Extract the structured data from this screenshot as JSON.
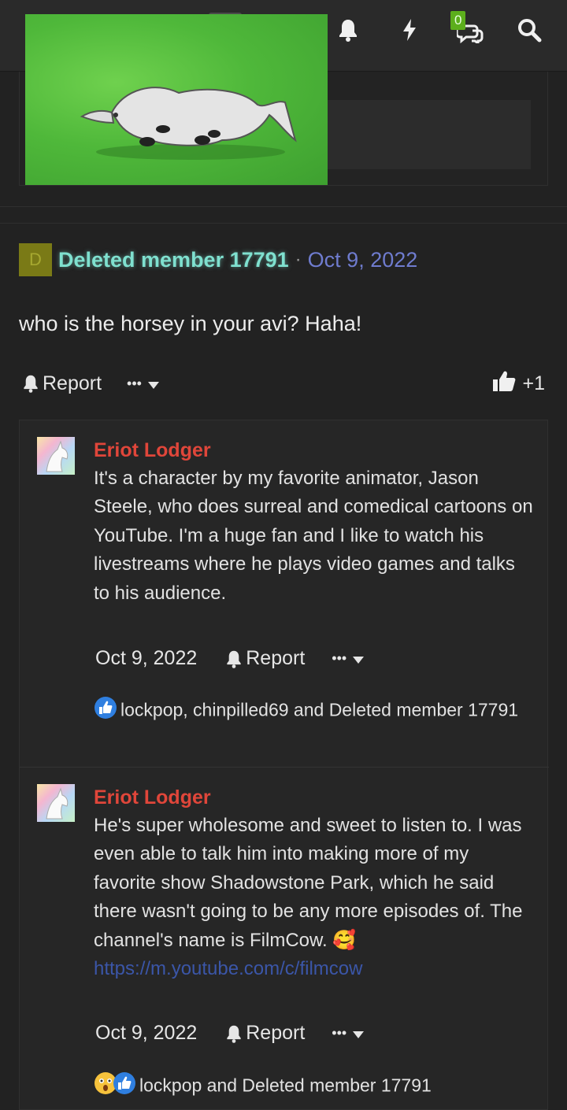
{
  "header": {
    "alert_badge": "0",
    "icons": [
      "bell-icon",
      "bolt-icon",
      "conversations-icon",
      "search-icon"
    ]
  },
  "post": {
    "avatar_letter": "D",
    "author": "Deleted member 17791",
    "separator": "·",
    "date": "Oct 9, 2022",
    "body": "who is the horsey in your avi? Haha!",
    "report_label": "Report",
    "more_label": "•••",
    "like_count": "+1"
  },
  "replies": [
    {
      "author": "Eriot Lodger",
      "text": "It's a character by my favorite animator, Jason Steele, who does surreal and comedical cartoons on YouTube. I'm a huge fan and I like to watch his livestreams where he plays video games and talks to his audience.",
      "link": "",
      "date": "Oct 9, 2022",
      "report_label": "Report",
      "more_label": "•••",
      "reactions": "lockpop, chinpilled69 and Deleted member 17791"
    },
    {
      "author": "Eriot Lodger",
      "text": "He's super wholesome and sweet to listen to. I was even able to talk him into making more of my favorite show Shadowstone Park, which he said there wasn't going to be any more episodes of. The channel's name is FilmCow. 🥰",
      "link": "https://m.youtube.com/c/filmcow",
      "date": "Oct 9, 2022",
      "report_label": "Report",
      "more_label": "•••",
      "reactions": "lockpop and Deleted member 17791"
    }
  ],
  "colors": {
    "background": "#222222",
    "author_main": "#7fe0cf",
    "date_main": "#6f7ccf",
    "reply_author": "#e0463a",
    "link": "#3b56a8",
    "badge": "#5cae1c"
  }
}
